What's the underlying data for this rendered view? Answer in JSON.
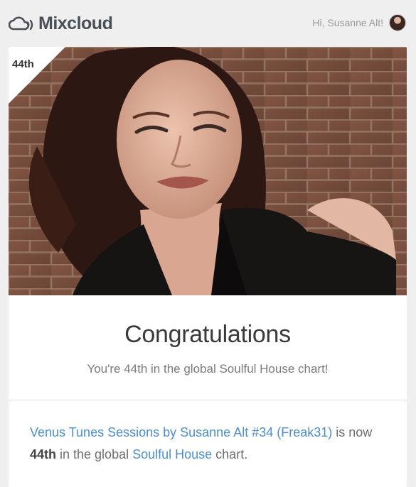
{
  "header": {
    "logo_text": "Mixcloud",
    "logo_icon": "cloud-sound-icon",
    "greeting": "Hi, Susanne Alt!"
  },
  "hero": {
    "rank_badge": "44th",
    "image": "artist-portrait-photo"
  },
  "congrats": {
    "title": "Congratulations",
    "subtitle": "You're 44th in the global Soulful House chart!"
  },
  "detail": {
    "show_link": "Venus Tunes Sessions by Susanne Alt #34 (Freak31)",
    "text_is": " is now ",
    "rank": "44th",
    "text_in": " in the global ",
    "genre_link": "Soulful House",
    "text_end": " chart."
  },
  "colors": {
    "link": "#4f8ec9",
    "background": "#efefef",
    "logo": "#4a4f55"
  }
}
